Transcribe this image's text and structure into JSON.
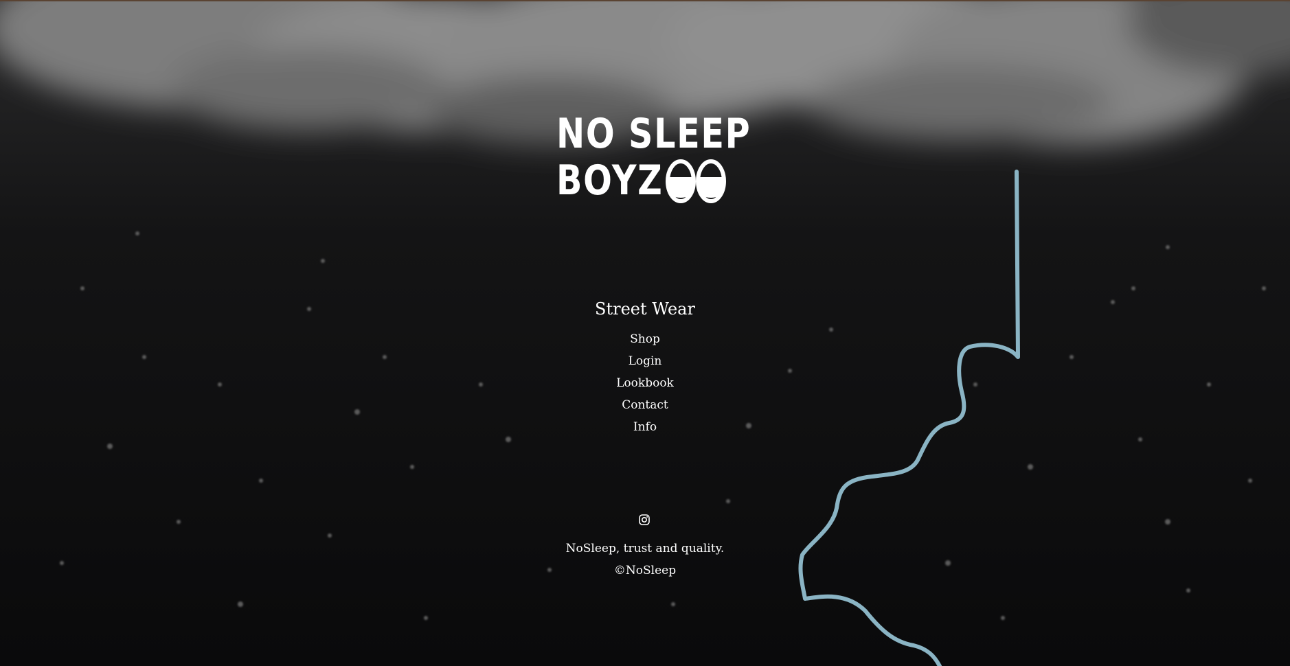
{
  "brand": {
    "logo_line_1": "NO SLEEP",
    "logo_line_2": "BOYZ"
  },
  "nav": {
    "heading": "Street Wear",
    "items": [
      {
        "label": "Shop"
      },
      {
        "label": "Login"
      },
      {
        "label": "Lookbook"
      },
      {
        "label": "Contact"
      },
      {
        "label": "Info"
      }
    ]
  },
  "social": {
    "icon": "instagram-icon"
  },
  "footer": {
    "tagline": "NoSleep, trust and quality.",
    "copyright": "©NoSleep"
  },
  "colors": {
    "background": "#0b0b0c",
    "cloud": "#9a9a9a",
    "lightning": "#8ab4c4",
    "text": "#ffffff"
  }
}
